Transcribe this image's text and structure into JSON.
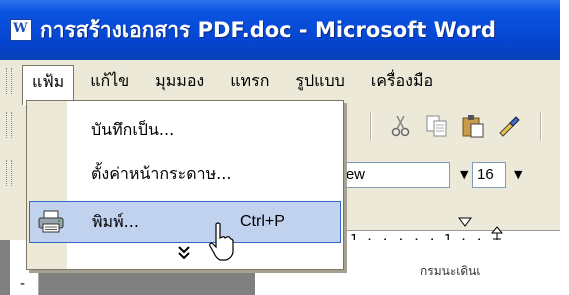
{
  "window": {
    "title": "การสร้างเอกสาร PDF.doc - Microsoft Word"
  },
  "menubar": {
    "items": [
      {
        "label": "แฟ้ม"
      },
      {
        "label": "แก้ไข"
      },
      {
        "label": "มุมมอง"
      },
      {
        "label": "แทรก"
      },
      {
        "label": "รูปแบบ"
      },
      {
        "label": "เครื่องมือ"
      }
    ]
  },
  "file_menu": {
    "items": [
      {
        "label": "บันทึกเป็น..."
      },
      {
        "label": "ตั้งค่าหน้ากระดาษ..."
      },
      {
        "label": "พิมพ์...",
        "shortcut": "Ctrl+P",
        "highlighted": true
      }
    ],
    "expand_glyph": "»"
  },
  "formatting": {
    "font_name": "New",
    "font_size": "16"
  },
  "ruler": {
    "text": "1 · · ·   · · 1 · ·"
  },
  "left_ruler": {
    "text": "-"
  },
  "document": {
    "text": "กรมนะเดินเ"
  },
  "colors": {
    "titlebar": "#0545d0",
    "menu_bg": "#ece9d8",
    "highlight": "#c1d2ee",
    "highlight_border": "#316ac5"
  },
  "icons": [
    "word-doc-icon",
    "cut-icon",
    "copy-icon",
    "paste-icon",
    "format-painter-icon",
    "printer-icon",
    "expand-chevron-icon",
    "mouse-pointer-icon"
  ]
}
